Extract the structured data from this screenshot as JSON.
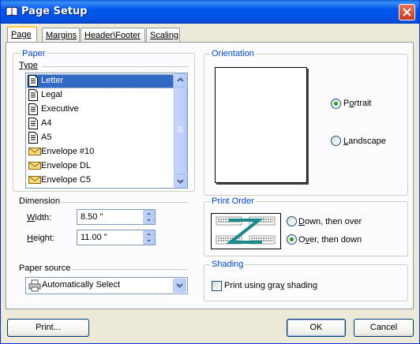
{
  "window": {
    "title": "Page Setup"
  },
  "tabs": [
    {
      "label": "Page"
    },
    {
      "label": "Margins"
    },
    {
      "label": "Header\\Footer"
    },
    {
      "label": "Scaling"
    }
  ],
  "paper": {
    "group_label": "Paper",
    "type_label": "Type",
    "types": [
      {
        "label": "Letter",
        "icon": "document-icon",
        "selected": true
      },
      {
        "label": "Legal",
        "icon": "document-icon"
      },
      {
        "label": "Executive",
        "icon": "document-icon"
      },
      {
        "label": "A4",
        "icon": "document-icon"
      },
      {
        "label": "A5",
        "icon": "document-icon"
      },
      {
        "label": "Envelope #10",
        "icon": "envelope-icon"
      },
      {
        "label": "Envelope DL",
        "icon": "envelope-icon"
      },
      {
        "label": "Envelope C5",
        "icon": "envelope-icon"
      }
    ]
  },
  "dimension": {
    "label": "Dimension",
    "width_label": "Width:",
    "width_value": "8.50 \"",
    "height_label": "Height:",
    "height_value": "11.00 \""
  },
  "paper_source": {
    "label": "Paper source",
    "value": "Automatically Select"
  },
  "orientation": {
    "label": "Orientation",
    "portrait": "Portrait",
    "landscape": "Landscape",
    "selected": "portrait"
  },
  "print_order": {
    "label": "Print Order",
    "down_then_over": "Down, then over",
    "over_then_down": "Over, then down",
    "selected": "over_then_down"
  },
  "shading": {
    "label": "Shading",
    "gray_shading": "Print using gray shading",
    "checked": false
  },
  "buttons": {
    "print": "Print...",
    "ok": "OK",
    "cancel": "Cancel"
  },
  "colors": {
    "titlebar": "#0058ee",
    "group_label": "#0046d5",
    "selection": "#316ac5",
    "dialog_bg": "#ece9d8"
  }
}
